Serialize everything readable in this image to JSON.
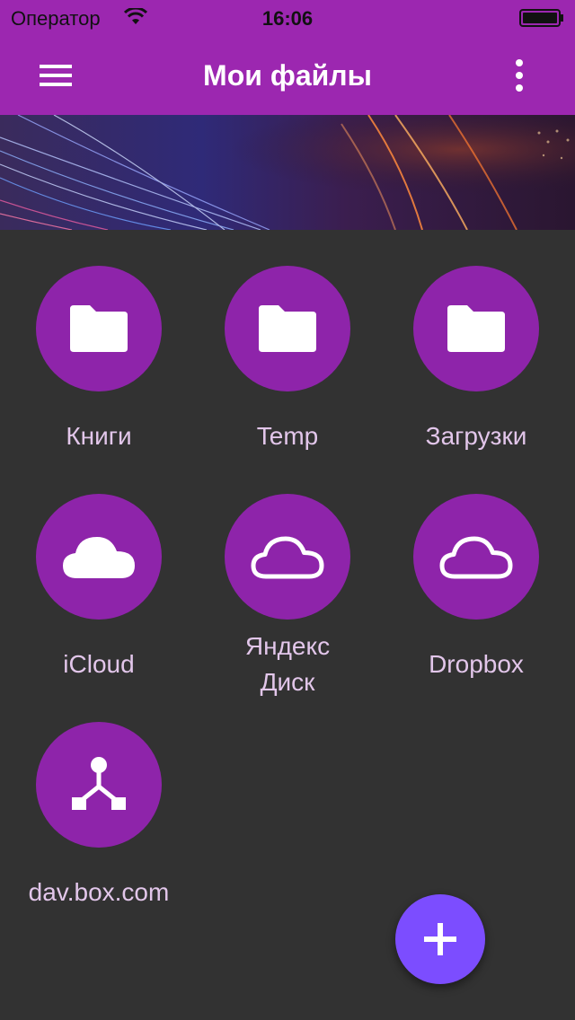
{
  "status_bar": {
    "carrier": "Оператор",
    "time": "16:06"
  },
  "app_bar": {
    "title": "Мои файлы",
    "menu_icon": "hamburger-icon",
    "more_icon": "more-vert-icon",
    "color": "#9c27b0"
  },
  "locations": [
    {
      "label": "Книги",
      "icon": "folder-icon"
    },
    {
      "label": "Temp",
      "icon": "folder-icon"
    },
    {
      "label": "Загрузки",
      "icon": "folder-icon"
    },
    {
      "label": "iCloud",
      "icon": "cloud-filled-icon"
    },
    {
      "label_line1": "Яндекс",
      "label_line2": "Диск",
      "icon": "cloud-outline-icon"
    },
    {
      "label": "Dropbox",
      "icon": "cloud-outline-icon"
    },
    {
      "label": "dav.box.com",
      "icon": "network-icon"
    }
  ],
  "fab": {
    "icon": "plus-icon",
    "color": "#7c4dff"
  },
  "colors": {
    "circle": "#8e24aa",
    "background": "#323232",
    "label": "#e2c6ea"
  }
}
